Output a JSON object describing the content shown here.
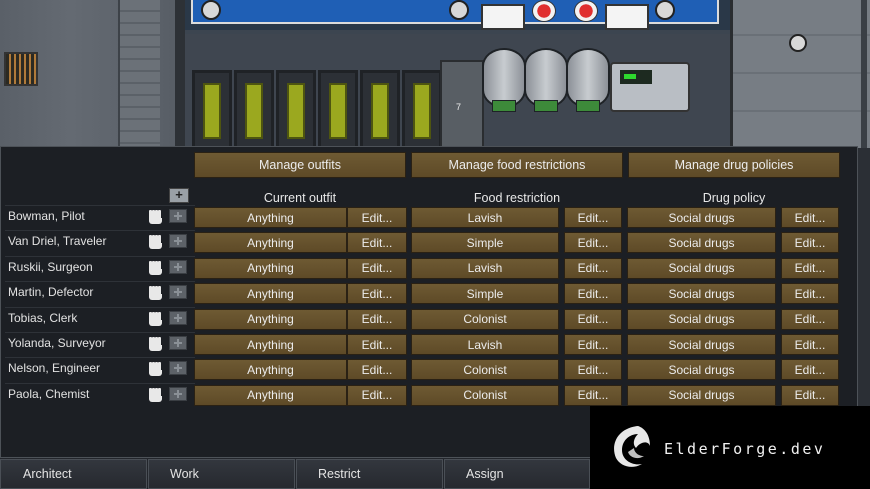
{
  "map_counter": "7",
  "top_buttons": {
    "outfits": "Manage outfits",
    "food": "Manage food restrictions",
    "drug": "Manage drug policies"
  },
  "columns": {
    "outfit": "Current outfit",
    "food": "Food restriction",
    "drug": "Drug policy"
  },
  "add_button": "+",
  "edit_label": "Edit...",
  "colonists": [
    {
      "name": "Bowman, Pilot",
      "outfit": "Anything",
      "food": "Lavish",
      "drug": "Social drugs"
    },
    {
      "name": "Van Driel, Traveler",
      "outfit": "Anything",
      "food": "Simple",
      "drug": "Social drugs"
    },
    {
      "name": "Ruskii, Surgeon",
      "outfit": "Anything",
      "food": "Lavish",
      "drug": "Social drugs"
    },
    {
      "name": "Martin, Defector",
      "outfit": "Anything",
      "food": "Simple",
      "drug": "Social drugs"
    },
    {
      "name": "Tobias, Clerk",
      "outfit": "Anything",
      "food": "Colonist",
      "drug": "Social drugs"
    },
    {
      "name": "Yolanda, Surveyor",
      "outfit": "Anything",
      "food": "Lavish",
      "drug": "Social drugs"
    },
    {
      "name": "Nelson, Engineer",
      "outfit": "Anything",
      "food": "Colonist",
      "drug": "Social drugs"
    },
    {
      "name": "Paola, Chemist",
      "outfit": "Anything",
      "food": "Colonist",
      "drug": "Social drugs"
    }
  ],
  "tabs": [
    "Architect",
    "Work",
    "Restrict",
    "Assign"
  ],
  "watermark": "ElderForge.dev",
  "colors": {
    "button": "#6e5a33",
    "panel": "#1c1f24",
    "blue_counter": "#1f5fb5"
  }
}
